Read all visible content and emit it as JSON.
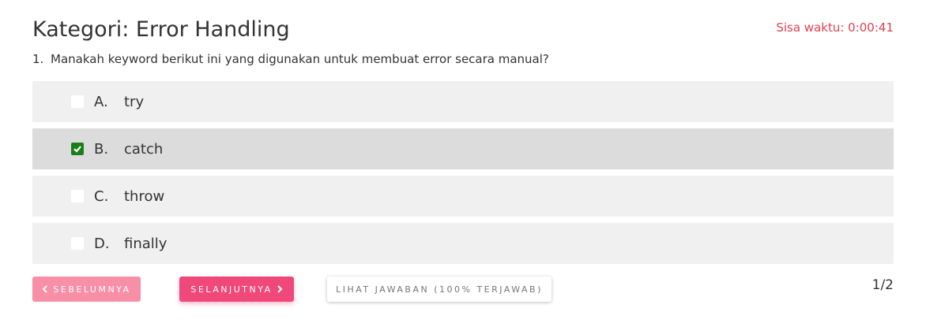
{
  "header": {
    "title": "Kategori: Error Handling",
    "timer": "Sisa waktu: 0:00:41"
  },
  "question": {
    "number": "1.",
    "text": "Manakah keyword berikut ini yang digunakan untuk membuat error secara manual?"
  },
  "options": [
    {
      "letter": "A.",
      "text": "try",
      "selected": false
    },
    {
      "letter": "B.",
      "text": "catch",
      "selected": true
    },
    {
      "letter": "C.",
      "text": "throw",
      "selected": false
    },
    {
      "letter": "D.",
      "text": "finally",
      "selected": false
    }
  ],
  "footer": {
    "prev_label": "SEBELUMNYA",
    "next_label": "SELANJUTNYA",
    "answers_label": "LIHAT JAWABAN (100% TERJAWAB)",
    "page_indicator": "1/2"
  },
  "icons": {
    "prev": "chevron-left-icon",
    "next": "chevron-right-icon",
    "check": "check-icon"
  },
  "colors": {
    "timer": "#e0404f",
    "prev_button": "#f78fa7",
    "next_button": "#f0487a",
    "checked": "#1a7f1a",
    "option_bg": "#f0f0f0",
    "option_selected_bg": "#dcdcdc"
  }
}
